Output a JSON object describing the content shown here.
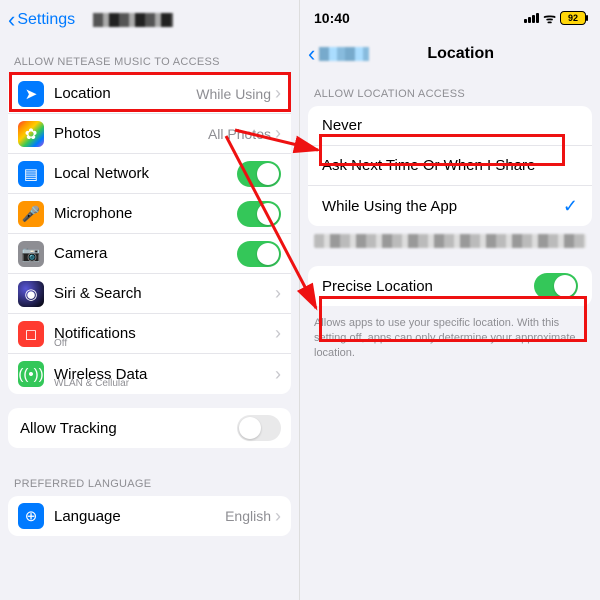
{
  "left": {
    "back": "Settings",
    "section1": "ALLOW NETEASE MUSIC TO ACCESS",
    "rows": [
      {
        "name": "location",
        "label": "Location",
        "value": "While Using"
      },
      {
        "name": "photos",
        "label": "Photos",
        "value": "All Photos"
      },
      {
        "name": "local-network",
        "label": "Local Network",
        "toggle": true
      },
      {
        "name": "microphone",
        "label": "Microphone",
        "toggle": true
      },
      {
        "name": "camera",
        "label": "Camera",
        "toggle": true
      },
      {
        "name": "siri",
        "label": "Siri & Search"
      },
      {
        "name": "notifications",
        "label": "Notifications",
        "sub": "Off"
      },
      {
        "name": "wireless-data",
        "label": "Wireless Data",
        "sub": "WLAN & Cellular"
      }
    ],
    "tracking": "Allow Tracking",
    "section2": "PREFERRED LANGUAGE",
    "language": {
      "label": "Language",
      "value": "English"
    }
  },
  "right": {
    "time": "10:40",
    "battery": "92",
    "title": "Location",
    "section": "ALLOW LOCATION ACCESS",
    "options": [
      {
        "label": "Never"
      },
      {
        "label": "Ask Next Time Or When I Share"
      },
      {
        "label": "While Using the App",
        "checked": true
      }
    ],
    "precise": "Precise Location",
    "desc": "Allows apps to use your specific location. With this setting off, apps can only determine your approximate location."
  }
}
